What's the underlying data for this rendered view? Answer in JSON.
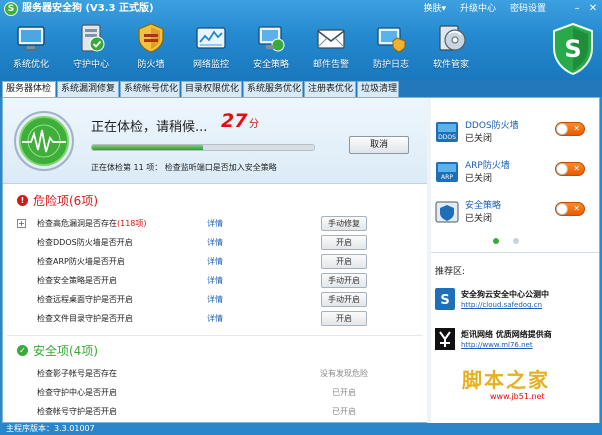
{
  "app": {
    "title": "服务器安全狗 (V3.3 正式版)",
    "logo_letter": "S"
  },
  "title_menu": [
    "换肤▾",
    "升级中心",
    "密码设置"
  ],
  "window_buttons": [
    "–",
    "✕"
  ],
  "toolbar": [
    {
      "label": "系统优化",
      "icon": "monitor-icon"
    },
    {
      "label": "守护中心",
      "icon": "guard-center-icon"
    },
    {
      "label": "防火墙",
      "icon": "firewall-shield-icon"
    },
    {
      "label": "网络监控",
      "icon": "network-monitor-icon"
    },
    {
      "label": "安全策略",
      "icon": "security-policy-icon"
    },
    {
      "label": "邮件告警",
      "icon": "mail-alert-icon"
    },
    {
      "label": "防护日志",
      "icon": "protection-log-icon"
    },
    {
      "label": "软件管家",
      "icon": "software-manager-icon"
    }
  ],
  "tabs": [
    "服务器体检",
    "系统漏洞修复",
    "系统帐号优化",
    "目录权限优化",
    "系统服务优化",
    "注册表优化",
    "垃圾清理"
  ],
  "scan": {
    "title": "正在体检，请稍候...",
    "score": "27",
    "score_unit": "分",
    "progress": 0.5,
    "step": "正在体检第 11 项：   检查监听端口是否加入安全策略",
    "cancel_label": "取消"
  },
  "danger": {
    "title": "危险项(6项)",
    "rows": [
      {
        "text": "检查高危漏洞是否存在",
        "sub": "(118项)",
        "link": "详情",
        "action": "手动修复",
        "expandable": true
      },
      {
        "text": "检查DDOS防火墙是否开启",
        "sub": "",
        "link": "详情",
        "action": "开启",
        "expandable": false
      },
      {
        "text": "检查ARP防火墙是否开启",
        "sub": "",
        "link": "详情",
        "action": "开启",
        "expandable": false
      },
      {
        "text": "检查安全策略是否开启",
        "sub": "",
        "link": "详情",
        "action": "手动开启",
        "expandable": false
      },
      {
        "text": "检查远程桌面守护是否开启",
        "sub": "",
        "link": "详情",
        "action": "手动开启",
        "expandable": false
      },
      {
        "text": "检查文件目录守护是否开启",
        "sub": "",
        "link": "详情",
        "action": "开启",
        "expandable": false
      }
    ]
  },
  "safe": {
    "title": "安全项(4项)",
    "rows": [
      {
        "text": "检查影子帐号是否存在",
        "status": "没有发现危险"
      },
      {
        "text": "检查守护中心是否开启",
        "status": "已开启"
      },
      {
        "text": "检查帐号守护是否开启",
        "status": "已开启"
      }
    ]
  },
  "switches": [
    {
      "name": "DDOS防火墙",
      "state": "已关闭",
      "icon": "ddos-firewall-icon",
      "badge": "DDOS"
    },
    {
      "name": "ARP防火墙",
      "state": "已关闭",
      "icon": "arp-firewall-icon",
      "badge": "ARP"
    },
    {
      "name": "安全策略",
      "state": "已关闭",
      "icon": "security-policy-shield-icon",
      "badge": ""
    }
  ],
  "toggle_mark": "✕",
  "recommend": {
    "title": "推荐区:",
    "items": [
      {
        "title": "安全狗云安全中心公测中",
        "url": "http://cloud.safedog.cn",
        "icon": "safedog-cloud-icon"
      },
      {
        "title": "炬讯网络 优质网络提供商",
        "url": "http://www.ml76.net",
        "icon": "juxun-network-icon"
      }
    ]
  },
  "watermark": {
    "text": "脚本之家",
    "url": "www.jb51.net"
  },
  "status_bar": {
    "version": "主程序版本：3.3.01007"
  },
  "colors": {
    "toolbar_blue": "#2489cf",
    "danger_red": "#d81818",
    "safe_green": "#3aa83a",
    "score_red": "#e01010",
    "toggle_orange": "#f07010"
  }
}
